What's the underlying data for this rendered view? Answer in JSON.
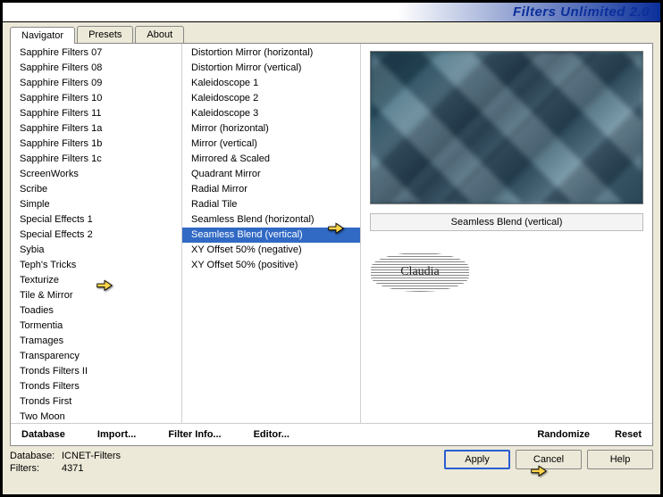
{
  "title": "Filters Unlimited 2.0",
  "tabs": {
    "navigator": "Navigator",
    "presets": "Presets",
    "about": "About"
  },
  "categories": [
    "Sapphire Filters 07",
    "Sapphire Filters 08",
    "Sapphire Filters 09",
    "Sapphire Filters 10",
    "Sapphire Filters 11",
    "Sapphire Filters 1a",
    "Sapphire Filters 1b",
    "Sapphire Filters 1c",
    "ScreenWorks",
    "Scribe",
    "Simple",
    "Special Effects 1",
    "Special Effects 2",
    "Sybia",
    "Teph's Tricks",
    "Texturize",
    "Tile & Mirror",
    "Toadies",
    "Tormentia",
    "Tramages",
    "Transparency",
    "Tronds Filters II",
    "Tronds Filters",
    "Tronds First",
    "Two Moon"
  ],
  "categories_selected_index": 16,
  "filters": [
    "Distortion Mirror (horizontal)",
    "Distortion Mirror (vertical)",
    "Kaleidoscope 1",
    "Kaleidoscope 2",
    "Kaleidoscope 3",
    "Mirror (horizontal)",
    "Mirror (vertical)",
    "Mirrored & Scaled",
    "Quadrant Mirror",
    "Radial Mirror",
    "Radial Tile",
    "Seamless Blend (horizontal)",
    "Seamless Blend (vertical)",
    "XY Offset 50% (negative)",
    "XY Offset 50% (positive)"
  ],
  "filters_selected_index": 12,
  "current_filter_name": "Seamless Blend (vertical)",
  "links": {
    "database": "Database",
    "import": "Import...",
    "filter_info": "Filter Info...",
    "editor": "Editor...",
    "randomize": "Randomize",
    "reset": "Reset"
  },
  "status": {
    "db_label": "Database:",
    "db_value": "ICNET-Filters",
    "filters_label": "Filters:",
    "filters_value": "4371"
  },
  "buttons": {
    "apply": "Apply",
    "cancel": "Cancel",
    "help": "Help"
  },
  "watermark": "Claudia"
}
